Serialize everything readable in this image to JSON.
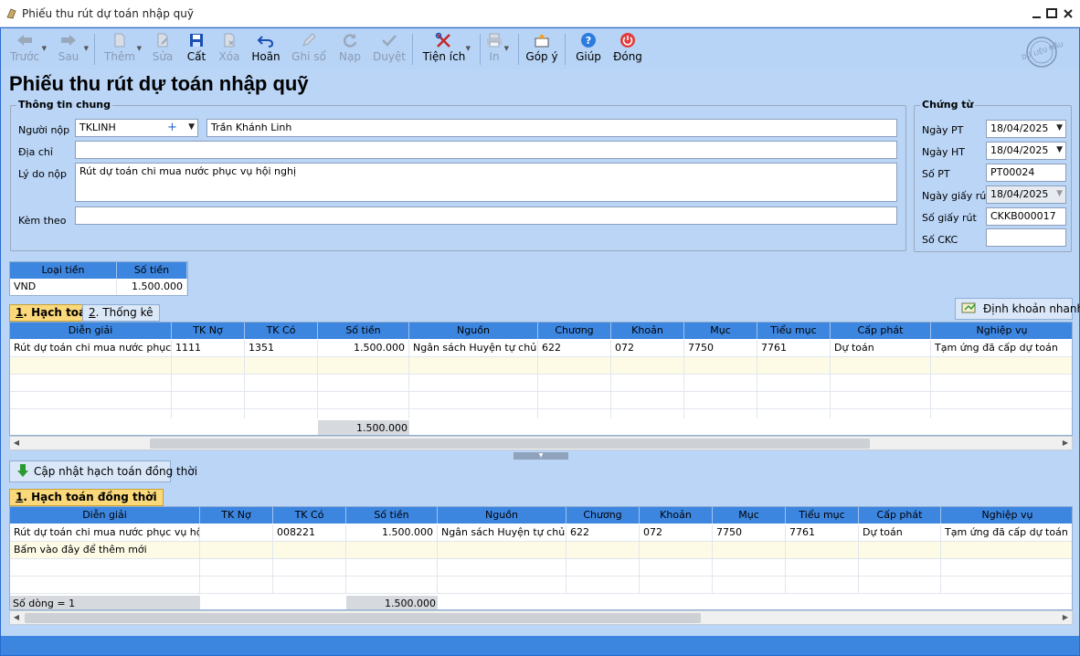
{
  "window": {
    "title": "Phiếu thu rút dự toán nhập quỹ"
  },
  "toolbar": {
    "prev": "Trước",
    "next": "Sau",
    "add": "Thêm",
    "edit": "Sửa",
    "save": "Cất",
    "delete": "Xóa",
    "undo": "Hoãn",
    "post": "Ghi sổ",
    "load": "Nạp",
    "approve": "Duyệt",
    "utilities": "Tiện ích",
    "print": "In",
    "feedback": "Góp ý",
    "help": "Giúp",
    "close": "Đóng"
  },
  "stamp": "DỮ LIỆU MẪU",
  "page_title": "Phiếu thu rút dự toán nhập quỹ",
  "general": {
    "group_title": "Thông tin chung",
    "payer_label": "Người nộp",
    "payer_code": "TKLINH",
    "payer_name": "Trần Khánh Linh",
    "address_label": "Địa chỉ",
    "address_value": "",
    "reason_label": "Lý do nộp",
    "reason_value": "Rút dự toán chi mua nước phục vụ hội nghị",
    "attach_label": "Kèm theo",
    "attach_value": ""
  },
  "voucher": {
    "group_title": "Chứng từ",
    "ngay_pt_label": "Ngày PT",
    "ngay_pt": "18/04/2025",
    "ngay_ht_label": "Ngày HT",
    "ngay_ht": "18/04/2025",
    "so_pt_label": "Số PT",
    "so_pt": "PT00024",
    "ngay_giay_rut_label": "Ngày giấy rút",
    "ngay_giay_rut": "18/04/2025",
    "so_giay_rut_label": "Số giấy rút",
    "so_giay_rut": "CKKB000017",
    "so_ckc_label": "Số CKC",
    "so_ckc": ""
  },
  "currency_table": {
    "headers": [
      "Loại tiền",
      "Số tiền"
    ],
    "row": [
      "VND",
      "1.500.000"
    ]
  },
  "tabs1": {
    "tab1_num": "1",
    "tab1_text": ". Hạch toán",
    "tab2_num": "2",
    "tab2_text": ". Thống kê"
  },
  "quick_btn": "Định khoản nhanh",
  "grid1": {
    "headers": [
      "Diễn giải",
      "TK Nợ",
      "TK Có",
      "Số tiền",
      "Nguồn",
      "Chương",
      "Khoản",
      "Mục",
      "Tiểu mục",
      "Cấp phát",
      "Nghiệp vụ"
    ],
    "row": [
      "Rút dự toán chi mua nước phục...",
      "1111",
      "1351",
      "1.500.000",
      "Ngân sách Huyện tự chủ",
      "622",
      "072",
      "7750",
      "7761",
      "Dự toán",
      "Tạm ứng đã cấp dự toán"
    ],
    "total": "1.500.000"
  },
  "update_btn": "Cập nhật hạch toán đồng thời",
  "tabs2": {
    "tab1_num": "1",
    "tab1_text": ". Hạch toán đồng thời"
  },
  "grid2": {
    "headers": [
      "Diễn giải",
      "TK Nợ",
      "TK Có",
      "Số tiền",
      "Nguồn",
      "Chương",
      "Khoản",
      "Mục",
      "Tiểu mục",
      "Cấp phát",
      "Nghiệp vụ"
    ],
    "row": [
      "Rút dự toán chi mua nước phục vụ hội...",
      "",
      "008221",
      "1.500.000",
      "Ngân sách Huyện tự chủ",
      "622",
      "072",
      "7750",
      "7761",
      "Dự toán",
      "Tạm ứng đã cấp dự toán"
    ],
    "add_hint": "Bấm vào đây để thêm mới",
    "row_count": "Số dòng = 1",
    "total": "1.500.000"
  },
  "colors": {
    "accent": "#3d86e0",
    "background": "#bad5f6",
    "highlight_row": "#fdfbe6",
    "active_tab": "#fbd97b"
  }
}
